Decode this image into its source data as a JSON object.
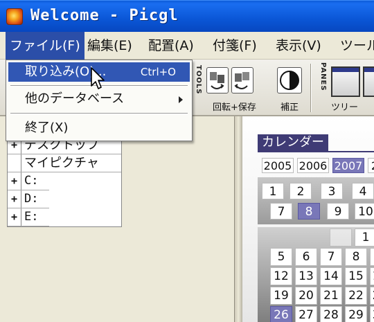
{
  "window": {
    "title": "Welcome - Picgl",
    "app_icon": "app-logo-icon"
  },
  "menubar": {
    "items": [
      {
        "label": "ファイル(F)",
        "active": true
      },
      {
        "label": "編集(E)"
      },
      {
        "label": "配置(A)"
      },
      {
        "label": "付箋(F)"
      },
      {
        "label": "表示(V)"
      },
      {
        "label": "ツール"
      }
    ]
  },
  "file_menu": {
    "items": [
      {
        "label": "取り込み(O)...",
        "shortcut": "Ctrl+O",
        "highlighted": true
      },
      {
        "label": "他のデータベース",
        "submenu": true
      },
      {
        "label": "終了(X)"
      }
    ]
  },
  "toolbar": {
    "tools_group_label": "TOOLS",
    "panes_group_label": "PANES",
    "buttons": [
      {
        "label": "回転+保存",
        "icon": "rotate-save-icon"
      },
      {
        "label": "補正",
        "icon": "contrast-correct-icon"
      },
      {
        "label": "ツリー",
        "icon": "tree-pane-icon"
      }
    ]
  },
  "tree": {
    "items": [
      {
        "toggle": "+",
        "label": "デスクトップ"
      },
      {
        "toggle": "",
        "label": "マイピクチャ"
      },
      {
        "toggle": "+",
        "label": "C:"
      },
      {
        "toggle": "+",
        "label": "D:"
      },
      {
        "toggle": "+",
        "label": "E:"
      }
    ]
  },
  "calendar": {
    "title": "カレンダー",
    "years": [
      "2005",
      "2006",
      "2007",
      "2"
    ],
    "selected_year": "2007",
    "months_row1": [
      "1",
      "2",
      "3",
      "4"
    ],
    "months_row2": [
      "7",
      "8",
      "9",
      "10"
    ],
    "selected_month": "8",
    "days": [
      [
        "",
        "",
        "",
        "1",
        ""
      ],
      [
        "5",
        "6",
        "7",
        "8",
        ""
      ],
      [
        "12",
        "13",
        "14",
        "15",
        "1"
      ],
      [
        "19",
        "20",
        "21",
        "22",
        "2"
      ],
      [
        "26",
        "27",
        "28",
        "29",
        "3"
      ]
    ],
    "selected_day": "26",
    "accent_color": "#7977b8",
    "header_color": "#3f3b75"
  },
  "colors": {
    "titlebar": "#0a56d6",
    "menu_highlight": "#2b4ea8",
    "item_highlight": "#3157b4"
  }
}
